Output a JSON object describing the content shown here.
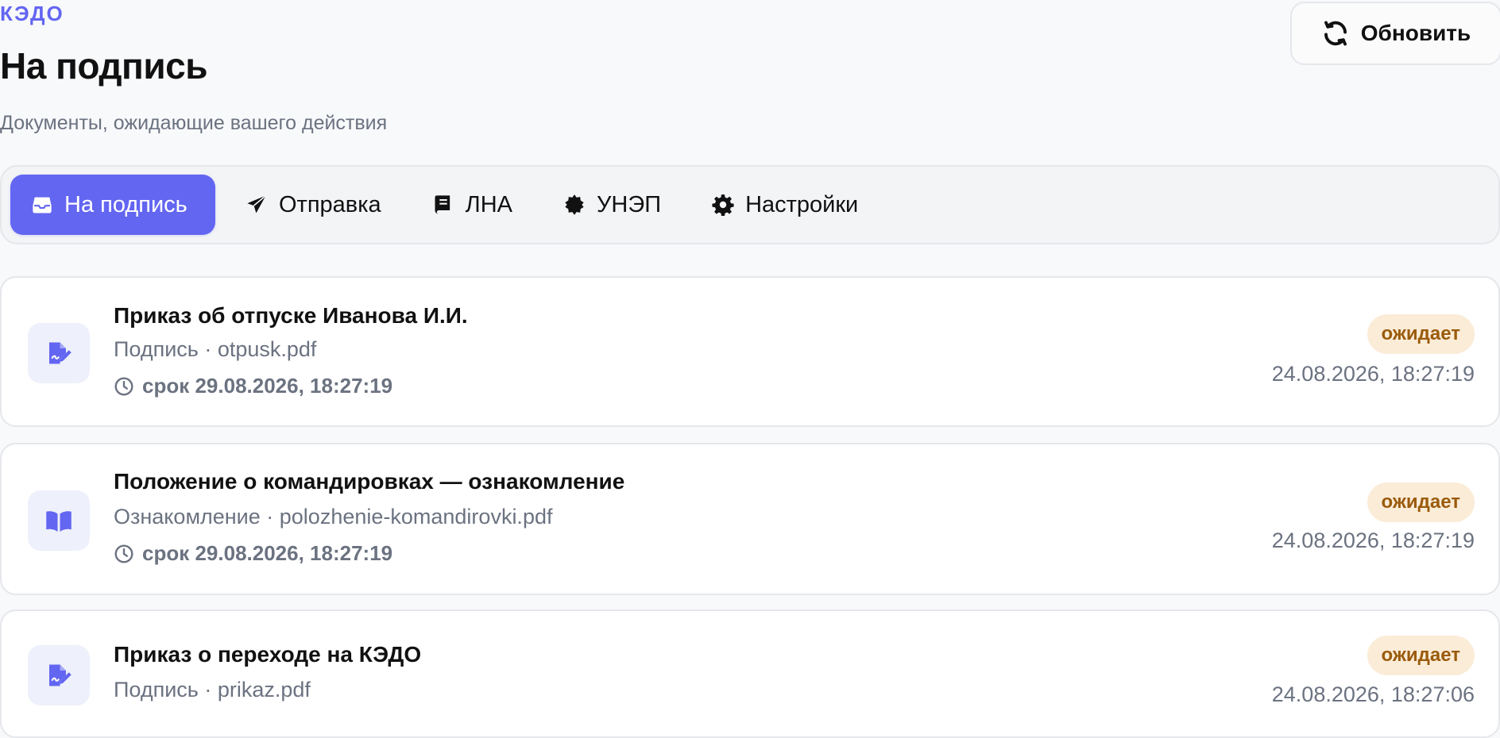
{
  "header": {
    "brand": "КЭДО",
    "title": "На подпись",
    "subtitle": "Документы, ожидающие вашего действия",
    "refresh_label": "Обновить"
  },
  "tabs": [
    {
      "label": "На подпись",
      "icon": "inbox-icon",
      "active": true
    },
    {
      "label": "Отправка",
      "icon": "paper-plane-icon",
      "active": false
    },
    {
      "label": "ЛНА",
      "icon": "book-icon",
      "active": false
    },
    {
      "label": "УНЭП",
      "icon": "certificate-icon",
      "active": false
    },
    {
      "label": "Настройки",
      "icon": "gear-icon",
      "active": false
    }
  ],
  "documents": [
    {
      "title": "Приказ об отпуске Иванова И.И.",
      "meta": "Подпись · otpusk.pdf",
      "deadline": "срок 29.08.2026, 18:27:19",
      "status": "ожидает",
      "date": "24.08.2026, 18:27:19",
      "icon": "signature-icon"
    },
    {
      "title": "Положение о командировках — ознакомление",
      "meta": "Ознакомление · polozhenie-komandirovki.pdf",
      "deadline": "срок 29.08.2026, 18:27:19",
      "status": "ожидает",
      "date": "24.08.2026, 18:27:19",
      "icon": "open-book-icon"
    },
    {
      "title": "Приказ о переходе на КЭДО",
      "meta": "Подпись · prikaz.pdf",
      "deadline": "",
      "status": "ожидает",
      "date": "24.08.2026, 18:27:06",
      "icon": "signature-icon"
    }
  ],
  "colors": {
    "accent": "#6366f1",
    "status_bg": "#fbecd8",
    "status_text": "#9a5b0b",
    "muted_text": "#6b7280"
  }
}
